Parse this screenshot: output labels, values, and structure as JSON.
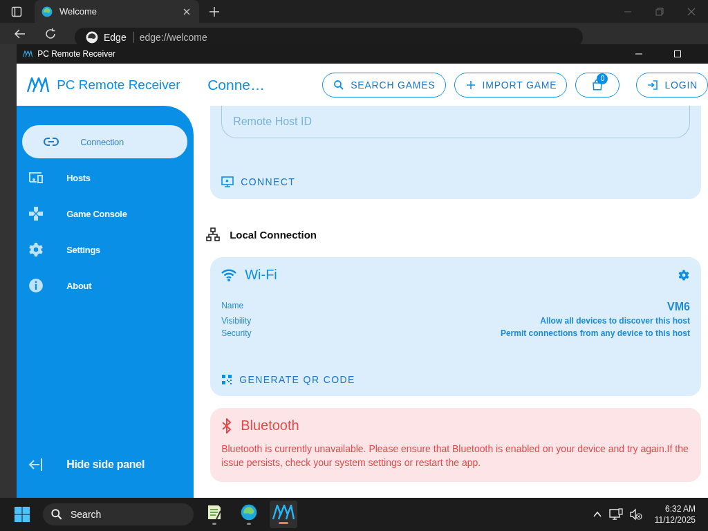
{
  "browser": {
    "tab_title": "Welcome",
    "site_label": "Edge",
    "address": "edge://welcome"
  },
  "app_window": {
    "title": "PC Remote Receiver"
  },
  "header": {
    "app_name": "PC Remote Receiver",
    "page_title": "Conne…",
    "buttons": [
      {
        "kind": "search",
        "label": "SEARCH GAMES"
      },
      {
        "kind": "import",
        "label": "IMPORT GAME"
      },
      {
        "kind": "cart",
        "badge": "0"
      },
      {
        "kind": "login",
        "label": "LOGIN"
      }
    ]
  },
  "sidebar": {
    "items": [
      {
        "kind": "link",
        "label": "Connection",
        "selected": true
      },
      {
        "kind": "hosts",
        "label": "Hosts",
        "selected": false
      },
      {
        "kind": "gamepad",
        "label": "Game Console",
        "selected": false
      },
      {
        "kind": "gear",
        "label": "Settings",
        "selected": false
      },
      {
        "kind": "info",
        "label": "About",
        "selected": false
      }
    ],
    "footer": "Hide side panel"
  },
  "remote_card": {
    "placeholder": "Remote Host ID",
    "button": "CONNECT"
  },
  "local_section": {
    "title": "Local Connection"
  },
  "wifi_card": {
    "title": "Wi-Fi",
    "rows": [
      {
        "label": "Name",
        "value": "VM6",
        "kind": "large"
      },
      {
        "label": "Visibility",
        "value": "Allow all devices to discover this host",
        "kind": "small"
      },
      {
        "label": "Security",
        "value": "Permit connections from any device to this host",
        "kind": "small"
      }
    ],
    "button": "GENERATE QR CODE"
  },
  "bluetooth_card": {
    "title": "Bluetooth",
    "message": "Bluetooth is currently unavailable. Please ensure that Bluetooth is enabled on your device and try again.If the issue persists, check your system settings or restart the app."
  },
  "taskbar": {
    "search": "Search",
    "apps": [
      {
        "kind": "notepad",
        "selected": false
      },
      {
        "kind": "edge",
        "selected": false
      },
      {
        "kind": "receiver",
        "selected": true
      }
    ],
    "time": "6:32 AM",
    "date": "11/12/2025"
  }
}
